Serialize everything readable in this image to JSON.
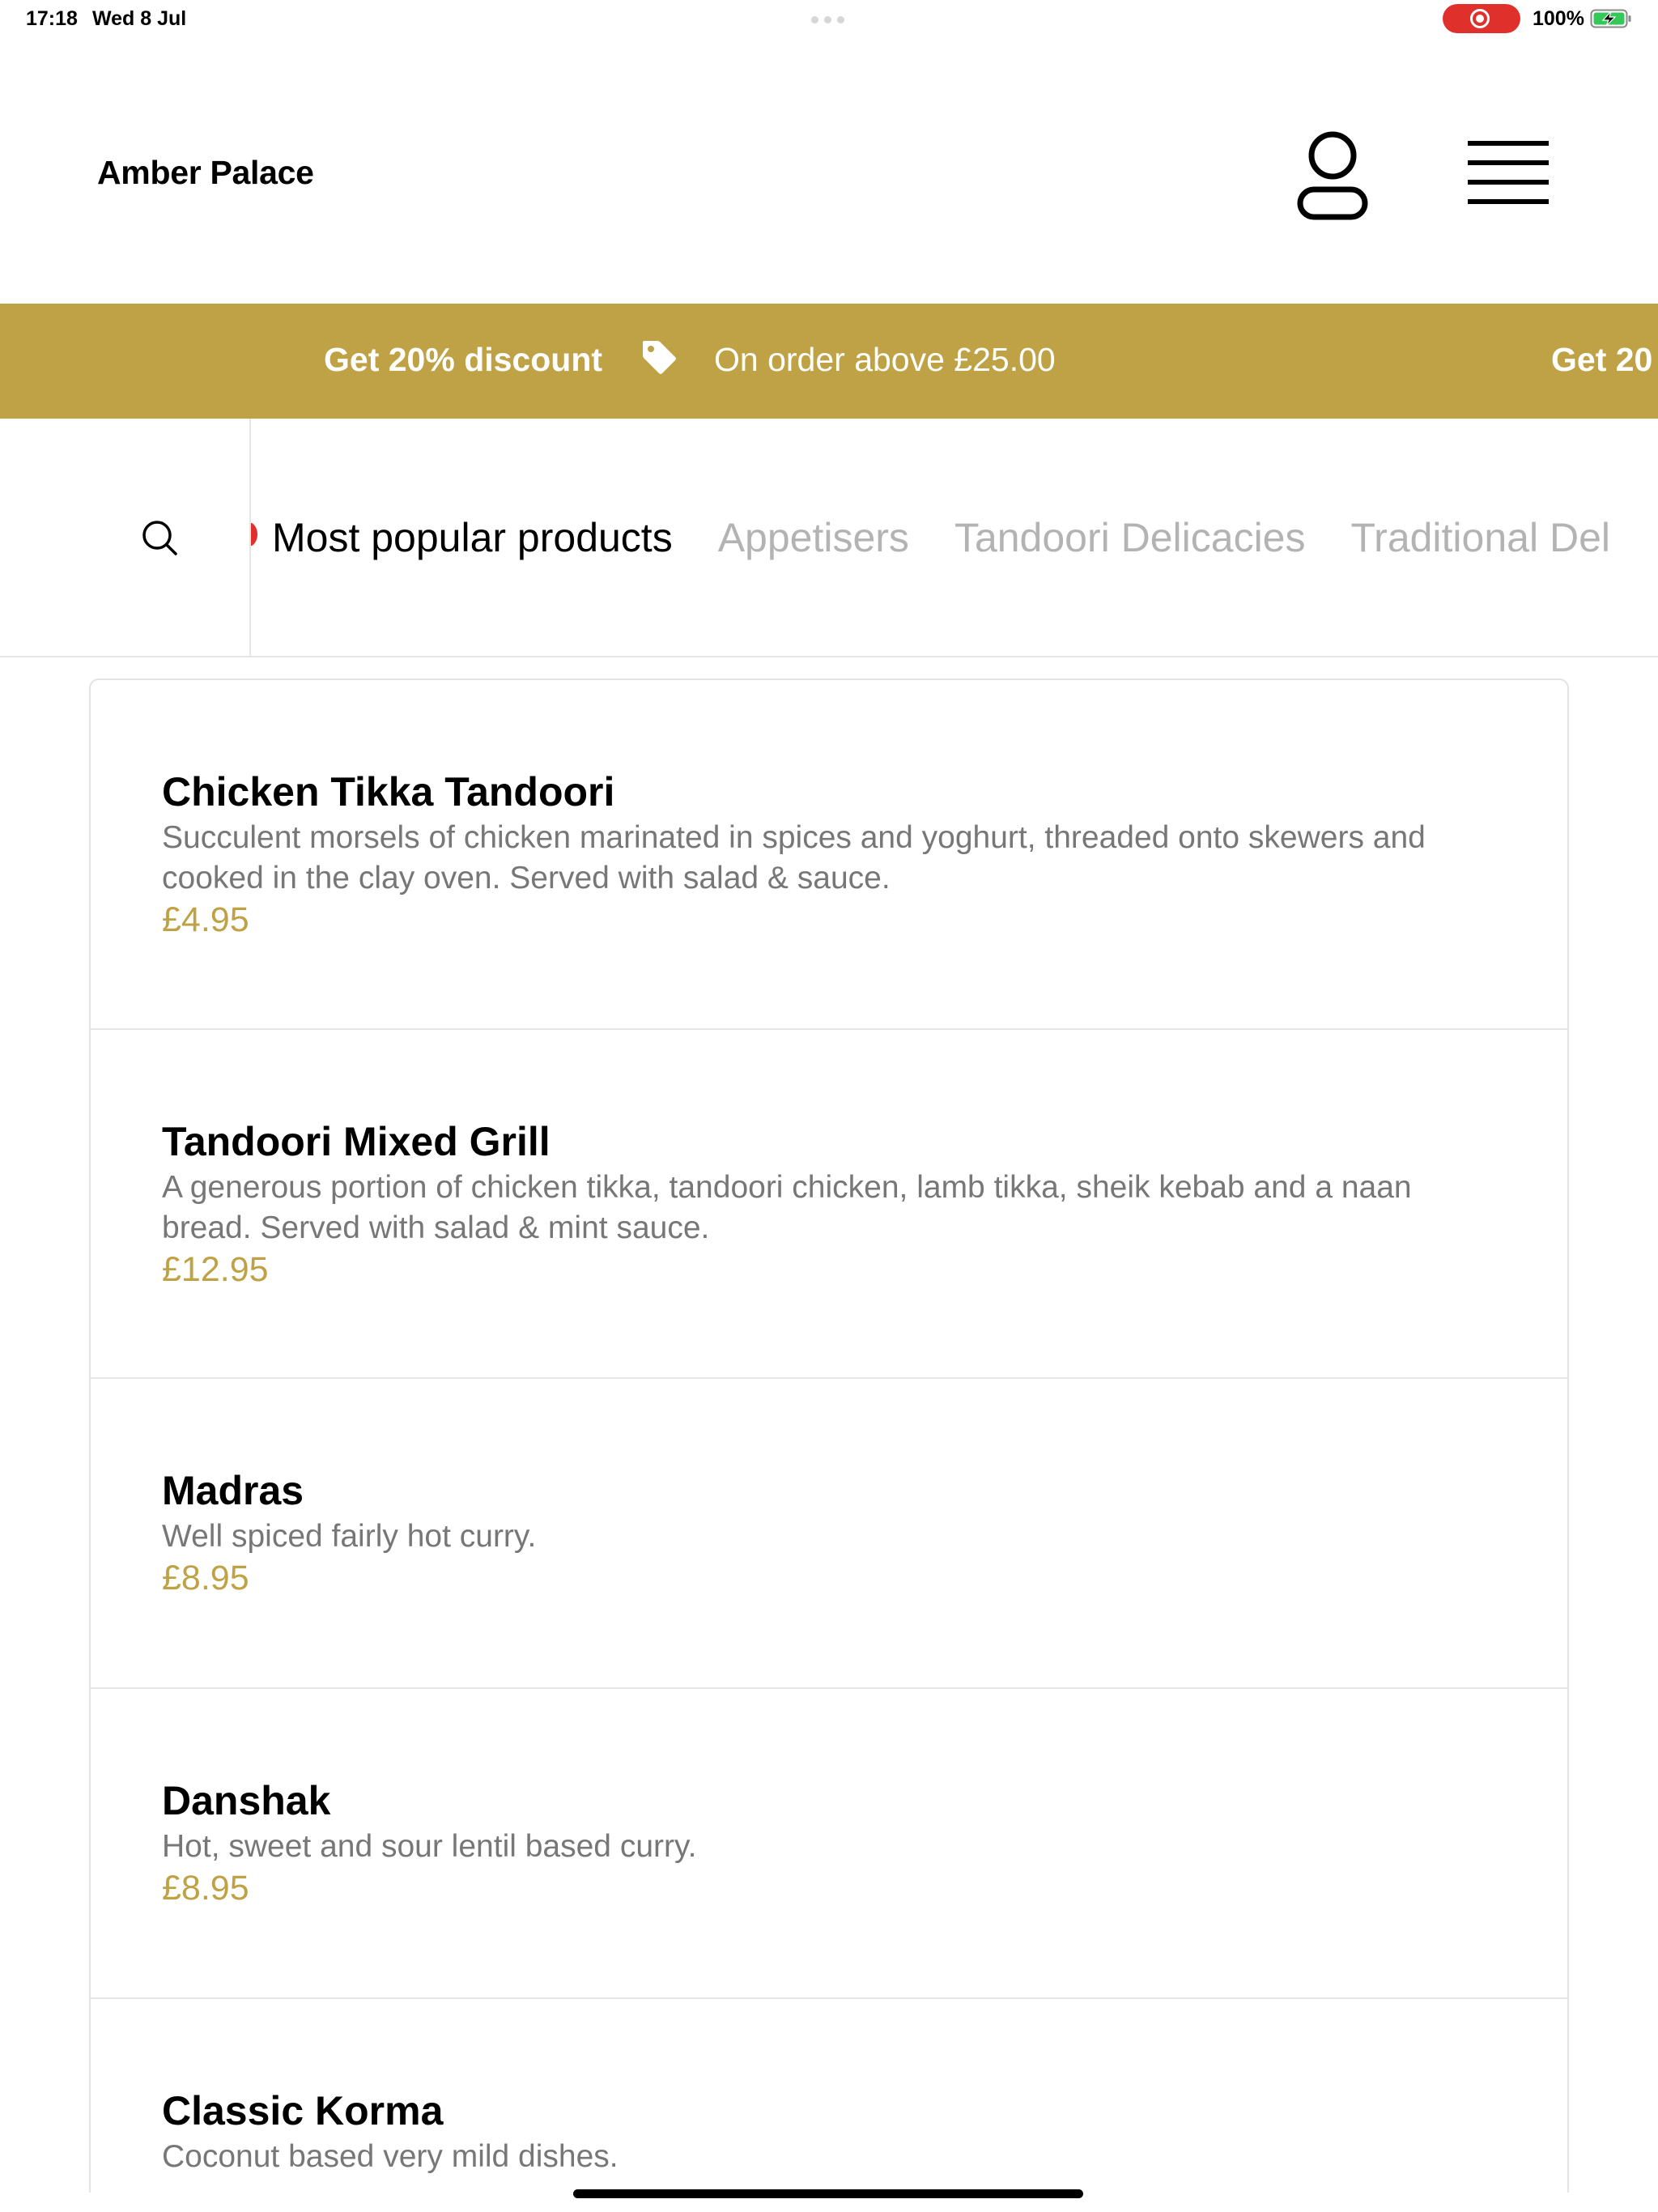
{
  "status_bar": {
    "time": "17:18",
    "date": "Wed 8 Jul",
    "battery": "100%",
    "record_color": "#e0302b"
  },
  "header": {
    "brand": "Amber Palace",
    "user_icon": "user-icon",
    "menu_icon": "hamburger-menu-icon"
  },
  "promo": {
    "title": "Get 20% discount",
    "subtitle": "On order above £25.00",
    "title_repeat": "Get 20",
    "icon": "tag-icon",
    "background": "#bfa245"
  },
  "categories": [
    {
      "label": "Most popular products",
      "active": true
    },
    {
      "label": "Appetisers",
      "active": false
    },
    {
      "label": "Tandoori Delicacies",
      "active": false
    },
    {
      "label": "Traditional Del",
      "active": false
    }
  ],
  "products": [
    {
      "name": "Chicken Tikka Tandoori",
      "desc_line1": "Succulent morsels of chicken marinated in spices and yoghurt, threaded onto skewers and",
      "desc_line2": "cooked in the clay oven. Served with salad & sauce.",
      "price": "£4.95"
    },
    {
      "name": "Tandoori Mixed Grill",
      "desc_line1": "A generous portion of chicken tikka, tandoori chicken, lamb tikka, sheik kebab and a naan",
      "desc_line2": "bread. Served with salad & mint sauce.",
      "price": "£12.95"
    },
    {
      "name": "Madras",
      "desc_line1": "Well spiced fairly hot curry.",
      "price": "£8.95"
    },
    {
      "name": "Danshak",
      "desc_line1": "Hot, sweet and sour lentil based curry.",
      "price": "£8.95"
    },
    {
      "name": "Classic Korma",
      "desc_line1": "Coconut based very mild dishes."
    }
  ],
  "accent_color": "#bfa245"
}
